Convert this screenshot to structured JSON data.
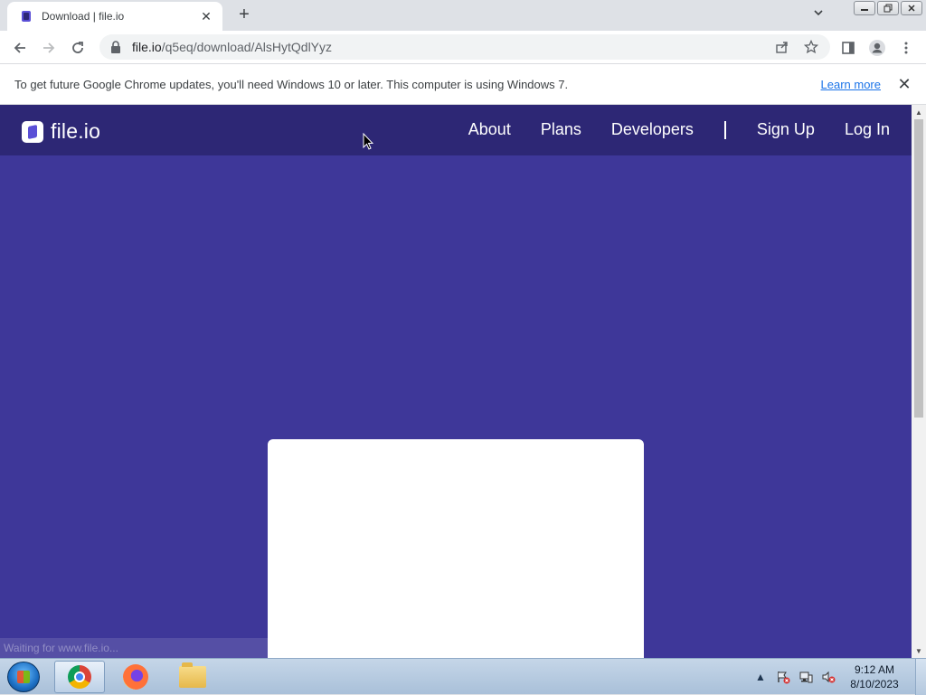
{
  "browser": {
    "tab": {
      "title": "Download | file.io",
      "favicon": "file-io-logo"
    },
    "new_tab_label": "+",
    "url": {
      "host": "file.io",
      "path": "/q5eq/download/AlsHytQdlYyz"
    },
    "window_buttons": [
      "minimize",
      "restore",
      "close"
    ]
  },
  "infobar": {
    "message": "To get future Google Chrome updates, you'll need Windows 10 or later. This computer is using Windows 7.",
    "link": "Learn more"
  },
  "site": {
    "logo_text": "file.io",
    "nav": {
      "about": "About",
      "plans": "Plans",
      "developers": "Developers",
      "sign_up": "Sign Up",
      "log_in": "Log In"
    },
    "status_text": "Waiting for www.file.io...",
    "colors": {
      "header": "#2d2775",
      "background": "#3e3799",
      "card": "#ffffff"
    }
  },
  "taskbar": {
    "apps": [
      "chrome",
      "firefox",
      "file-explorer"
    ],
    "clock": {
      "time": "9:12 AM",
      "date": "8/10/2023"
    }
  }
}
